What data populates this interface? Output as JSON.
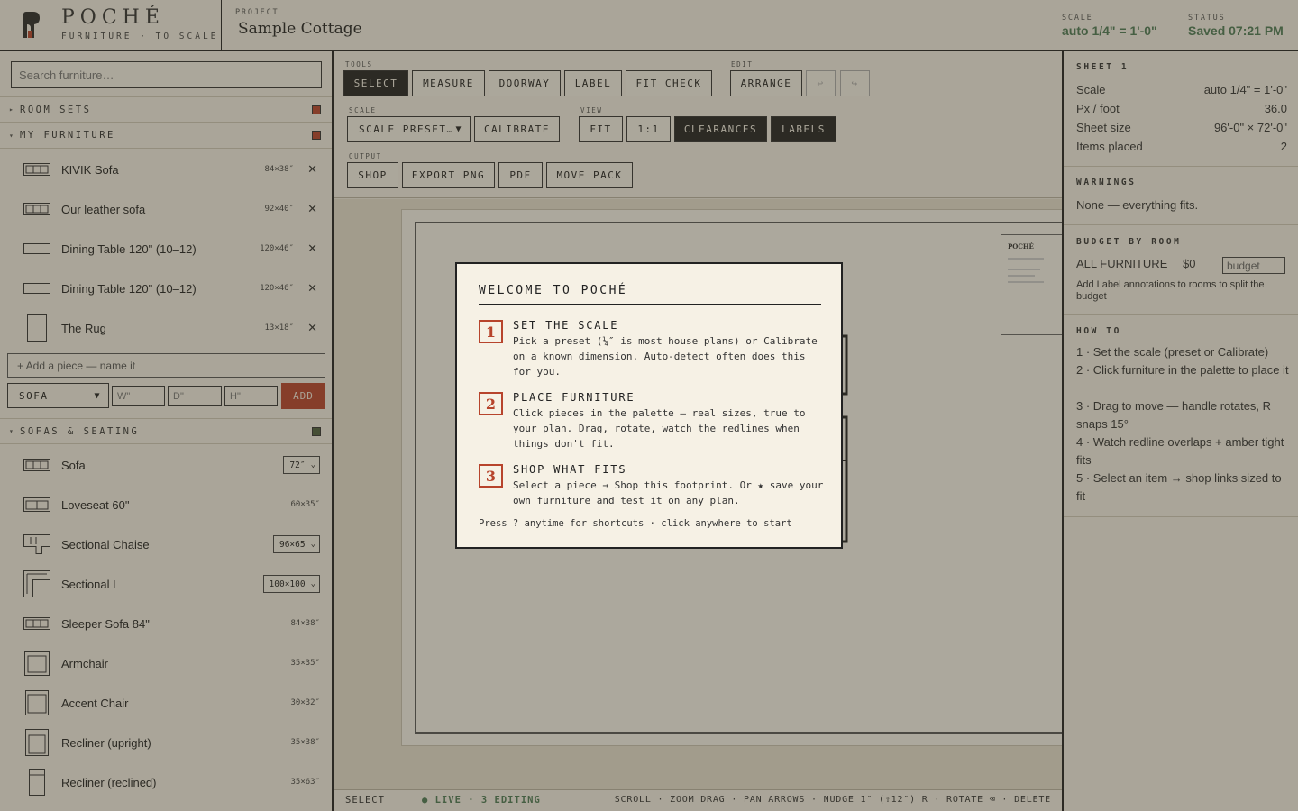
{
  "header": {
    "brand": "POCHÉ",
    "tagline": "FURNITURE · TO SCALE",
    "project_caption": "PROJECT",
    "project_name": "Sample Cottage",
    "scale_caption": "SCALE",
    "scale_value": "auto 1/4\" = 1'-0\"",
    "status_caption": "STATUS",
    "status_value": "Saved 07:21 PM",
    "accent": "#b7442c",
    "ok_color": "#4e7a55"
  },
  "left": {
    "search_placeholder": "Search furniture…",
    "room_sets_label": "ROOM SETS",
    "my_furniture_label": "MY FURNITURE",
    "my_furniture": [
      {
        "name": "KIVIK Sofa",
        "dims": "84×38″",
        "icon": "sofa-icon"
      },
      {
        "name": "Our leather sofa",
        "dims": "92×40″",
        "icon": "sofa-icon"
      },
      {
        "name": "Dining Table 120\" (10–12)",
        "dims": "120×46″",
        "icon": "table-icon"
      },
      {
        "name": "Dining Table 120\" (10–12)",
        "dims": "120×46″",
        "icon": "table-icon"
      },
      {
        "name": "The Rug",
        "dims": "13×18″",
        "icon": "rug-icon"
      }
    ],
    "add_piece_placeholder": "+ Add a piece — name it",
    "category_value": "SOFA",
    "w_placeholder": "W\"",
    "d_placeholder": "D\"",
    "h_placeholder": "H\"",
    "add_label": "ADD",
    "sofas_label": "SOFAS & SEATING",
    "sofas": [
      {
        "name": "Sofa",
        "select": "72″",
        "icon": "sofa-icon"
      },
      {
        "name": "Loveseat 60\"",
        "dims": "60×35″",
        "icon": "loveseat-icon"
      },
      {
        "name": "Sectional Chaise",
        "select": "96×65",
        "icon": "sectional-chaise-icon"
      },
      {
        "name": "Sectional L",
        "select": "100×100",
        "icon": "sectional-l-icon"
      },
      {
        "name": "Sleeper Sofa 84\"",
        "dims": "84×38″",
        "icon": "sofa-icon"
      },
      {
        "name": "Armchair",
        "dims": "35×35″",
        "icon": "armchair-icon"
      },
      {
        "name": "Accent Chair",
        "dims": "30×32″",
        "icon": "chair-icon"
      },
      {
        "name": "Recliner (upright)",
        "dims": "35×38″",
        "icon": "recliner-icon"
      },
      {
        "name": "Recliner (reclined)",
        "dims": "35×63″",
        "icon": "recliner-icon"
      }
    ]
  },
  "toolbar": {
    "tools_caption": "TOOLS",
    "select": "SELECT",
    "measure": "MEASURE",
    "doorway": "DOORWAY",
    "label": "LABEL",
    "fit_check": "FIT CHECK",
    "edit_caption": "EDIT",
    "arrange": "ARRANGE",
    "undo": "↩",
    "redo": "↪",
    "scale_caption": "SCALE",
    "scale_preset": "SCALE PRESET…",
    "calibrate": "CALIBRATE",
    "view_caption": "VIEW",
    "fit": "FIT",
    "one_to_one": "1:1",
    "clearances": "CLEARANCES",
    "labels": "LABELS",
    "output_caption": "OUTPUT",
    "shop": "SHOP",
    "export_png": "EXPORT PNG",
    "pdf": "PDF",
    "move_pack": "MOVE PACK"
  },
  "titleblock": {
    "brand": "POCHÉ"
  },
  "statusbar": {
    "mode": "SELECT",
    "live": "● LIVE · 3 EDITING",
    "keys": "SCROLL · ZOOM DRAG · PAN ARROWS · NUDGE 1″ (⇧12″) R · ROTATE ⌫ · DELETE"
  },
  "right": {
    "sheet_caption": "SHEET 1",
    "sheet_rows": [
      {
        "k": "Scale",
        "v": "auto 1/4\" = 1'-0\""
      },
      {
        "k": "Px / foot",
        "v": "36.0"
      },
      {
        "k": "Sheet size",
        "v": "96'-0\" × 72'-0\""
      },
      {
        "k": "Items placed",
        "v": "2"
      }
    ],
    "warnings_caption": "WARNINGS",
    "warnings_text": "None — everything fits.",
    "budget_caption": "BUDGET BY ROOM",
    "budget_room": "ALL FURNITURE",
    "budget_amount": "$0",
    "budget_placeholder": "budget",
    "budget_hint": "Add Label annotations to rooms to split the budget",
    "howto_caption": "HOW TO",
    "howto": [
      "1 · Set the scale (preset or Calibrate)",
      "2 · Click furniture in the palette to place it",
      "3 · Drag to move — handle rotates, R snaps 15°",
      "4 · Watch redline overlaps + amber tight fits",
      "5 · Select an item → shop links sized to fit"
    ]
  },
  "modal": {
    "title": "WELCOME TO POCHÉ",
    "steps": [
      {
        "num": "1",
        "title": "SET THE SCALE",
        "body": "Pick a preset (¼″ is most house plans) or Calibrate on a known dimension. Auto-detect often does this for you."
      },
      {
        "num": "2",
        "title": "PLACE FURNITURE",
        "body": "Click pieces in the palette — real sizes, true to your plan. Drag, rotate, watch the redlines when things don't fit."
      },
      {
        "num": "3",
        "title": "SHOP WHAT FITS",
        "body": "Select a piece → Shop this footprint. Or ★ save your own furniture and test it on any plan."
      }
    ],
    "footer": "Press ? anytime for shortcuts · click anywhere to start"
  }
}
